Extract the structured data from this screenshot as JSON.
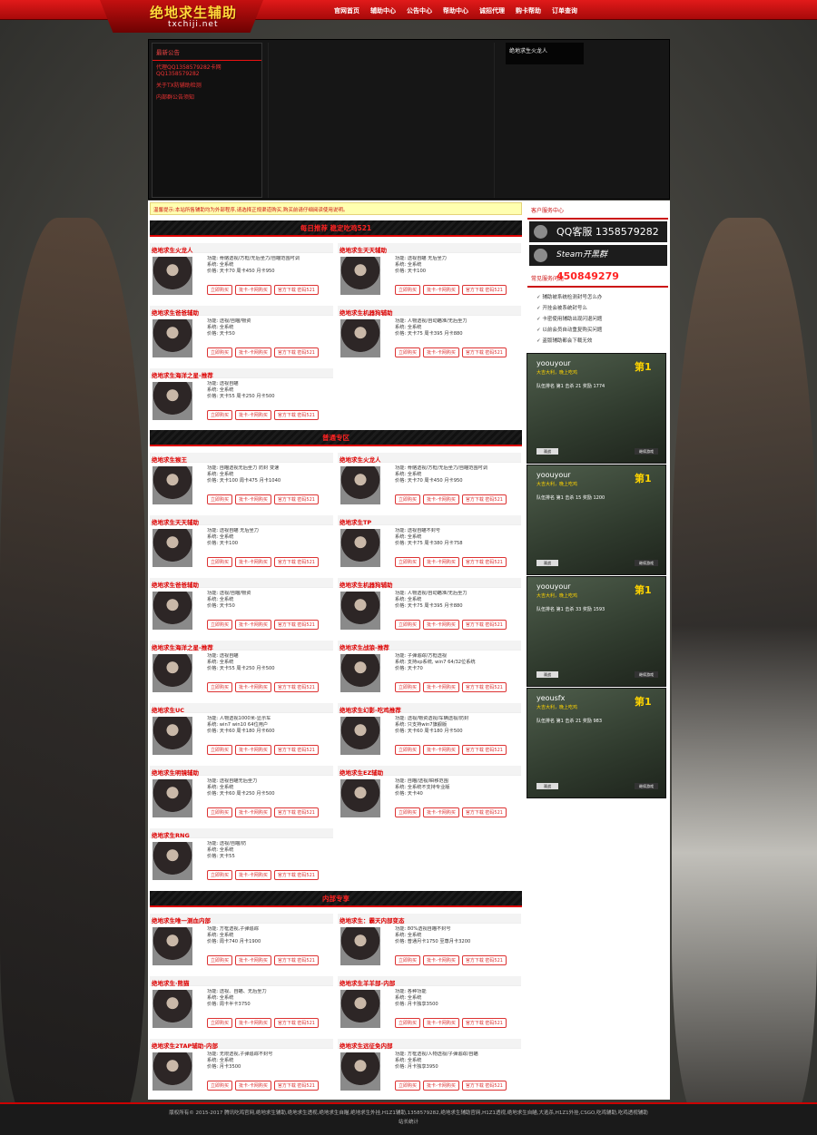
{
  "header": {
    "logo_title": "绝地求生辅助",
    "logo_domain": "txchiji.net",
    "nav": [
      "官网首页",
      "辅助中心",
      "公告中心",
      "帮助中心",
      "诚招代理",
      "购卡帮助",
      "订单查询"
    ]
  },
  "hero": {
    "notice_title": "最新公告",
    "notices": [
      "代理QQ1358579282卡网QQ1358579282",
      "关于TX防辅助检测",
      "内部群公告须知"
    ],
    "tag": "绝地求生火龙人"
  },
  "main": {
    "warning": "温馨提示:本站所售辅助均为外部程序,请选择正规渠道购买,购买前请仔细阅读使用说明。",
    "sections": {
      "recommend": "每日推荐 稳定吃鸡521",
      "normal": "普通专区",
      "internal": "内部专享"
    },
    "buttons": {
      "buy": "立即购买",
      "key": "批卡-卡网购买",
      "download": "官方下载 密码521"
    },
    "recommend_items": [
      {
        "title": "绝地求生火龙人",
        "lines": [
          "功能: 骨骼透视/方框/无后坐力/自瞄范围可调",
          "系统: 全系统",
          "价格: 天卡70 周卡450 月卡950"
        ]
      },
      {
        "title": "绝地求生天天辅助",
        "lines": [
          "功能: 透视自瞄 无后坐力",
          "系统: 全系统",
          "价格: 天卡100"
        ]
      },
      {
        "title": "绝地求生爸爸辅助",
        "lines": [
          "功能: 透视/自瞄/物资",
          "系统: 全系统",
          "价格: 天卡50"
        ]
      },
      {
        "title": "绝地求生机器狗辅助",
        "lines": [
          "功能: 人物透视/自动瞄准/无后坐力",
          "系统: 全系统",
          "价格: 天卡75 周卡395 月卡880"
        ]
      },
      {
        "title": "绝地求生海洋之星-推荐",
        "lines": [
          "功能: 透视自瞄",
          "系统: 全系统",
          "价格: 天卡55 周卡250 月卡500"
        ]
      }
    ],
    "normal_items": [
      {
        "title": "绝地求生猴王",
        "lines": [
          "功能: 自瞄透视无后坐力 防封 变速",
          "系统: 全系统",
          "价格: 天卡100 周卡475 月卡1040"
        ]
      },
      {
        "title": "绝地求生火龙人",
        "lines": [
          "功能: 骨骼透视/方框/无后坐力/自瞄范围可调",
          "系统: 全系统",
          "价格: 天卡70 周卡450 月卡950"
        ]
      },
      {
        "title": "绝地求生天天辅助",
        "lines": [
          "功能: 透视自瞄 无后坐力",
          "系统: 全系统",
          "价格: 天卡100"
        ]
      },
      {
        "title": "绝地求生TP",
        "lines": [
          "功能: 透视自瞄不封号",
          "系统: 全系统",
          "价格: 天卡75 周卡380 月卡758"
        ]
      },
      {
        "title": "绝地求生爸爸辅助",
        "lines": [
          "功能: 透视/自瞄/物资",
          "系统: 全系统",
          "价格: 天卡50"
        ]
      },
      {
        "title": "绝地求生机器狗辅助",
        "lines": [
          "功能: 人物透视/自动瞄准/无后坐力",
          "系统: 全系统",
          "价格: 天卡75 周卡395 月卡880"
        ]
      },
      {
        "title": "绝地求生海洋之星-推荐",
        "lines": [
          "功能: 透视自瞄",
          "系统: 全系统",
          "价格: 天卡55 周卡250 月卡500"
        ]
      },
      {
        "title": "绝地求生战狼-推荐",
        "lines": [
          "功能: 子弹追踪/方框透视",
          "系统: 支持xp系统, win7 64/32位系统",
          "价格: 天卡70"
        ]
      },
      {
        "title": "绝地求生UC",
        "lines": [
          "功能: 人物透视1000米-显示车",
          "系统: win7 win10 64位用户",
          "价格: 天卡60 周卡180 月卡600"
        ]
      },
      {
        "title": "绝地求生幻影-吃鸡推荐",
        "lines": [
          "功能: 透视/物资透视/车辆透视/防封",
          "系统: 只支持win7旗舰版",
          "价格: 天卡60 周卡180 月卡500"
        ]
      },
      {
        "title": "绝地求生明镜辅助",
        "lines": [
          "功能: 透视自瞄无后坐力",
          "系统: 全系统",
          "价格: 天卡60 周卡250 月卡500"
        ]
      },
      {
        "title": "绝地求生EZ辅助",
        "lines": [
          "功能: 自瞄/透视/瞬移范围",
          "系统: 全系统不支持专业版",
          "价格: 天卡40"
        ]
      },
      {
        "title": "绝地求生RNG",
        "lines": [
          "功能: 透视/自瞄/防",
          "系统: 全系统",
          "价格: 天卡55"
        ]
      }
    ],
    "internal_items": [
      {
        "title": "绝地求生唯一测血内部",
        "lines": [
          "功能: 方框透视,子弹追踪",
          "系统: 全系统",
          "价格: 周卡740 月卡1900"
        ]
      },
      {
        "title": "绝地求生：霸天内部变态",
        "lines": [
          "功能: 80%透视自瞄不封号",
          "系统: 全系统",
          "价格: 普通月卡1750 至尊月卡3200"
        ]
      },
      {
        "title": "绝地求生·熊猫",
        "lines": [
          "功能: 透视、自瞄、无后坐力",
          "系统: 全系统",
          "价格: 周卡半卡3750"
        ]
      },
      {
        "title": "绝地求生羊羊部-内部",
        "lines": [
          "功能: 各种功能",
          "系统: 全系统",
          "价格: 月卡独享3500"
        ]
      },
      {
        "title": "绝地求生2TAP辅助-内部",
        "lines": [
          "功能: 无限透视,子弹追踪不封号",
          "系统: 全系统",
          "价格: 月卡3500"
        ]
      },
      {
        "title": "绝地求生远征免内部",
        "lines": [
          "功能: 方框透视/人物透视/子弹追踪/自瞄",
          "系统: 全系统",
          "价格: 月卡独享3950"
        ]
      }
    ]
  },
  "sidebar": {
    "service_title": "客户服务中心",
    "qq_banner": "QQ客服 1358579282",
    "steam_banner_label": "Steam开黑群",
    "steam_banner_number": "450849279",
    "faq_title": "常见服务问题",
    "faq": [
      "辅助被系统检测封号怎么办",
      "开挂会被系统封号么",
      "卡密使用辅助出现闪退问题",
      "以前会员自动重复购买问题",
      "盗版辅助都会下载无效"
    ],
    "shots": [
      {
        "name": "yoouyour",
        "sub": "大吉大利，晚上吃鸡",
        "rank": "第1",
        "stat": "队伍排名 第1  击杀 21  奖励 1774",
        "b1": "观战",
        "b2": "继续游戏"
      },
      {
        "name": "yoouyour",
        "sub": "大吉大利，晚上吃鸡",
        "rank": "第1",
        "stat": "队伍排名 第1  击杀 15  奖励 1200",
        "b1": "观战",
        "b2": "继续游戏"
      },
      {
        "name": "yoouyour",
        "sub": "大吉大利，晚上吃鸡",
        "rank": "第1",
        "stat": "队伍排名 第1  击杀 33  奖励 1593",
        "b1": "观战",
        "b2": "继续游戏"
      },
      {
        "name": "yeousfx",
        "sub": "大吉大利，晚上吃鸡",
        "rank": "第1",
        "stat": "队伍排名 第1  击杀 21  奖励 983",
        "b1": "观战",
        "b2": "继续游戏"
      }
    ]
  },
  "footer": {
    "text": "版权所有© 2015-2017 腾讯吃鸡官网,绝地求生辅助,绝地求生透视,绝地求生自瞄,绝地求生外挂,H1Z1辅助,1358579282,绝地求生辅助官网,H1Z1透视,绝地求生自瞄,大逃杀,H1Z1外挂,CSGO,吃鸡辅助,吃鸡透视辅助",
    "stats": "站长统计"
  }
}
